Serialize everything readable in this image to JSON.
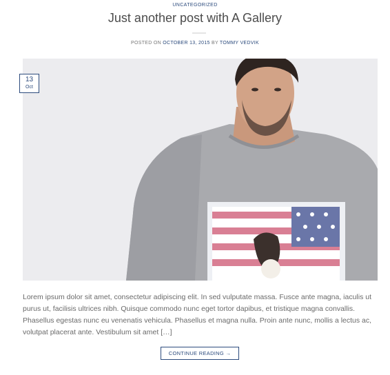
{
  "post": {
    "category": "Uncategorized",
    "title": "Just another post with A Gallery",
    "meta": {
      "posted_on_label": "Posted on",
      "date": "October 13, 2015",
      "by_label": "by",
      "author": "Tommy Vedvik"
    },
    "date_badge": {
      "day": "13",
      "month": "Oct"
    },
    "featured_image": "man-in-grey-tshirt-photo",
    "excerpt": "Lorem ipsum dolor sit amet, consectetur adipiscing elit. In sed vulputate massa. Fusce ante magna, iaculis ut purus ut, facilisis ultrices nibh. Quisque commodo nunc eget tortor dapibus, et tristique magna convallis. Phasellus egestas nunc eu venenatis vehicula. Phasellus et magna nulla. Proin ante nunc, mollis a lectus ac, volutpat placerat ante. Vestibulum sit amet […]",
    "continue_label": "Continue reading →"
  },
  "colors": {
    "accent": "#2b4a7c",
    "text": "#6a6a6a",
    "title": "#4b4b4b"
  }
}
